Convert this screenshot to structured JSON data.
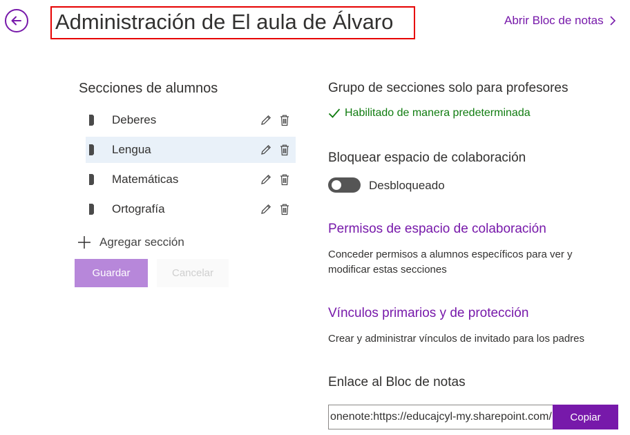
{
  "header": {
    "title": "Administración de El aula de Álvaro",
    "open_notebook_label": "Abrir Bloc de notas"
  },
  "sections": {
    "heading": "Secciones de alumnos",
    "items": [
      {
        "label": "Deberes",
        "selected": false
      },
      {
        "label": "Lengua",
        "selected": true
      },
      {
        "label": "Matemáticas",
        "selected": false
      },
      {
        "label": "Ortografía",
        "selected": false
      }
    ],
    "add_label": "Agregar sección",
    "save_label": "Guardar",
    "cancel_label": "Cancelar"
  },
  "teacher_group": {
    "heading": "Grupo de secciones solo para profesores",
    "status": "Habilitado de manera predeterminada"
  },
  "lock_space": {
    "heading": "Bloquear espacio de colaboración",
    "toggle_on": false,
    "state_label": "Desbloqueado"
  },
  "permissions": {
    "heading": "Permisos de espacio de colaboración",
    "description": "Conceder permisos a alumnos específicos para ver y modificar estas secciones"
  },
  "links": {
    "heading": "Vínculos primarios y de protección",
    "description": "Crear y administrar vínculos de invitado para los padres"
  },
  "notebook_link": {
    "heading": "Enlace al Bloc de notas",
    "value": "onenote:https://educajcyl-my.sharepoint.com/",
    "copy_label": "Copiar"
  },
  "colors": {
    "accent": "#7719aa",
    "success": "#107c10",
    "highlight": "#e60000",
    "selected_row": "#e9f1f9"
  }
}
